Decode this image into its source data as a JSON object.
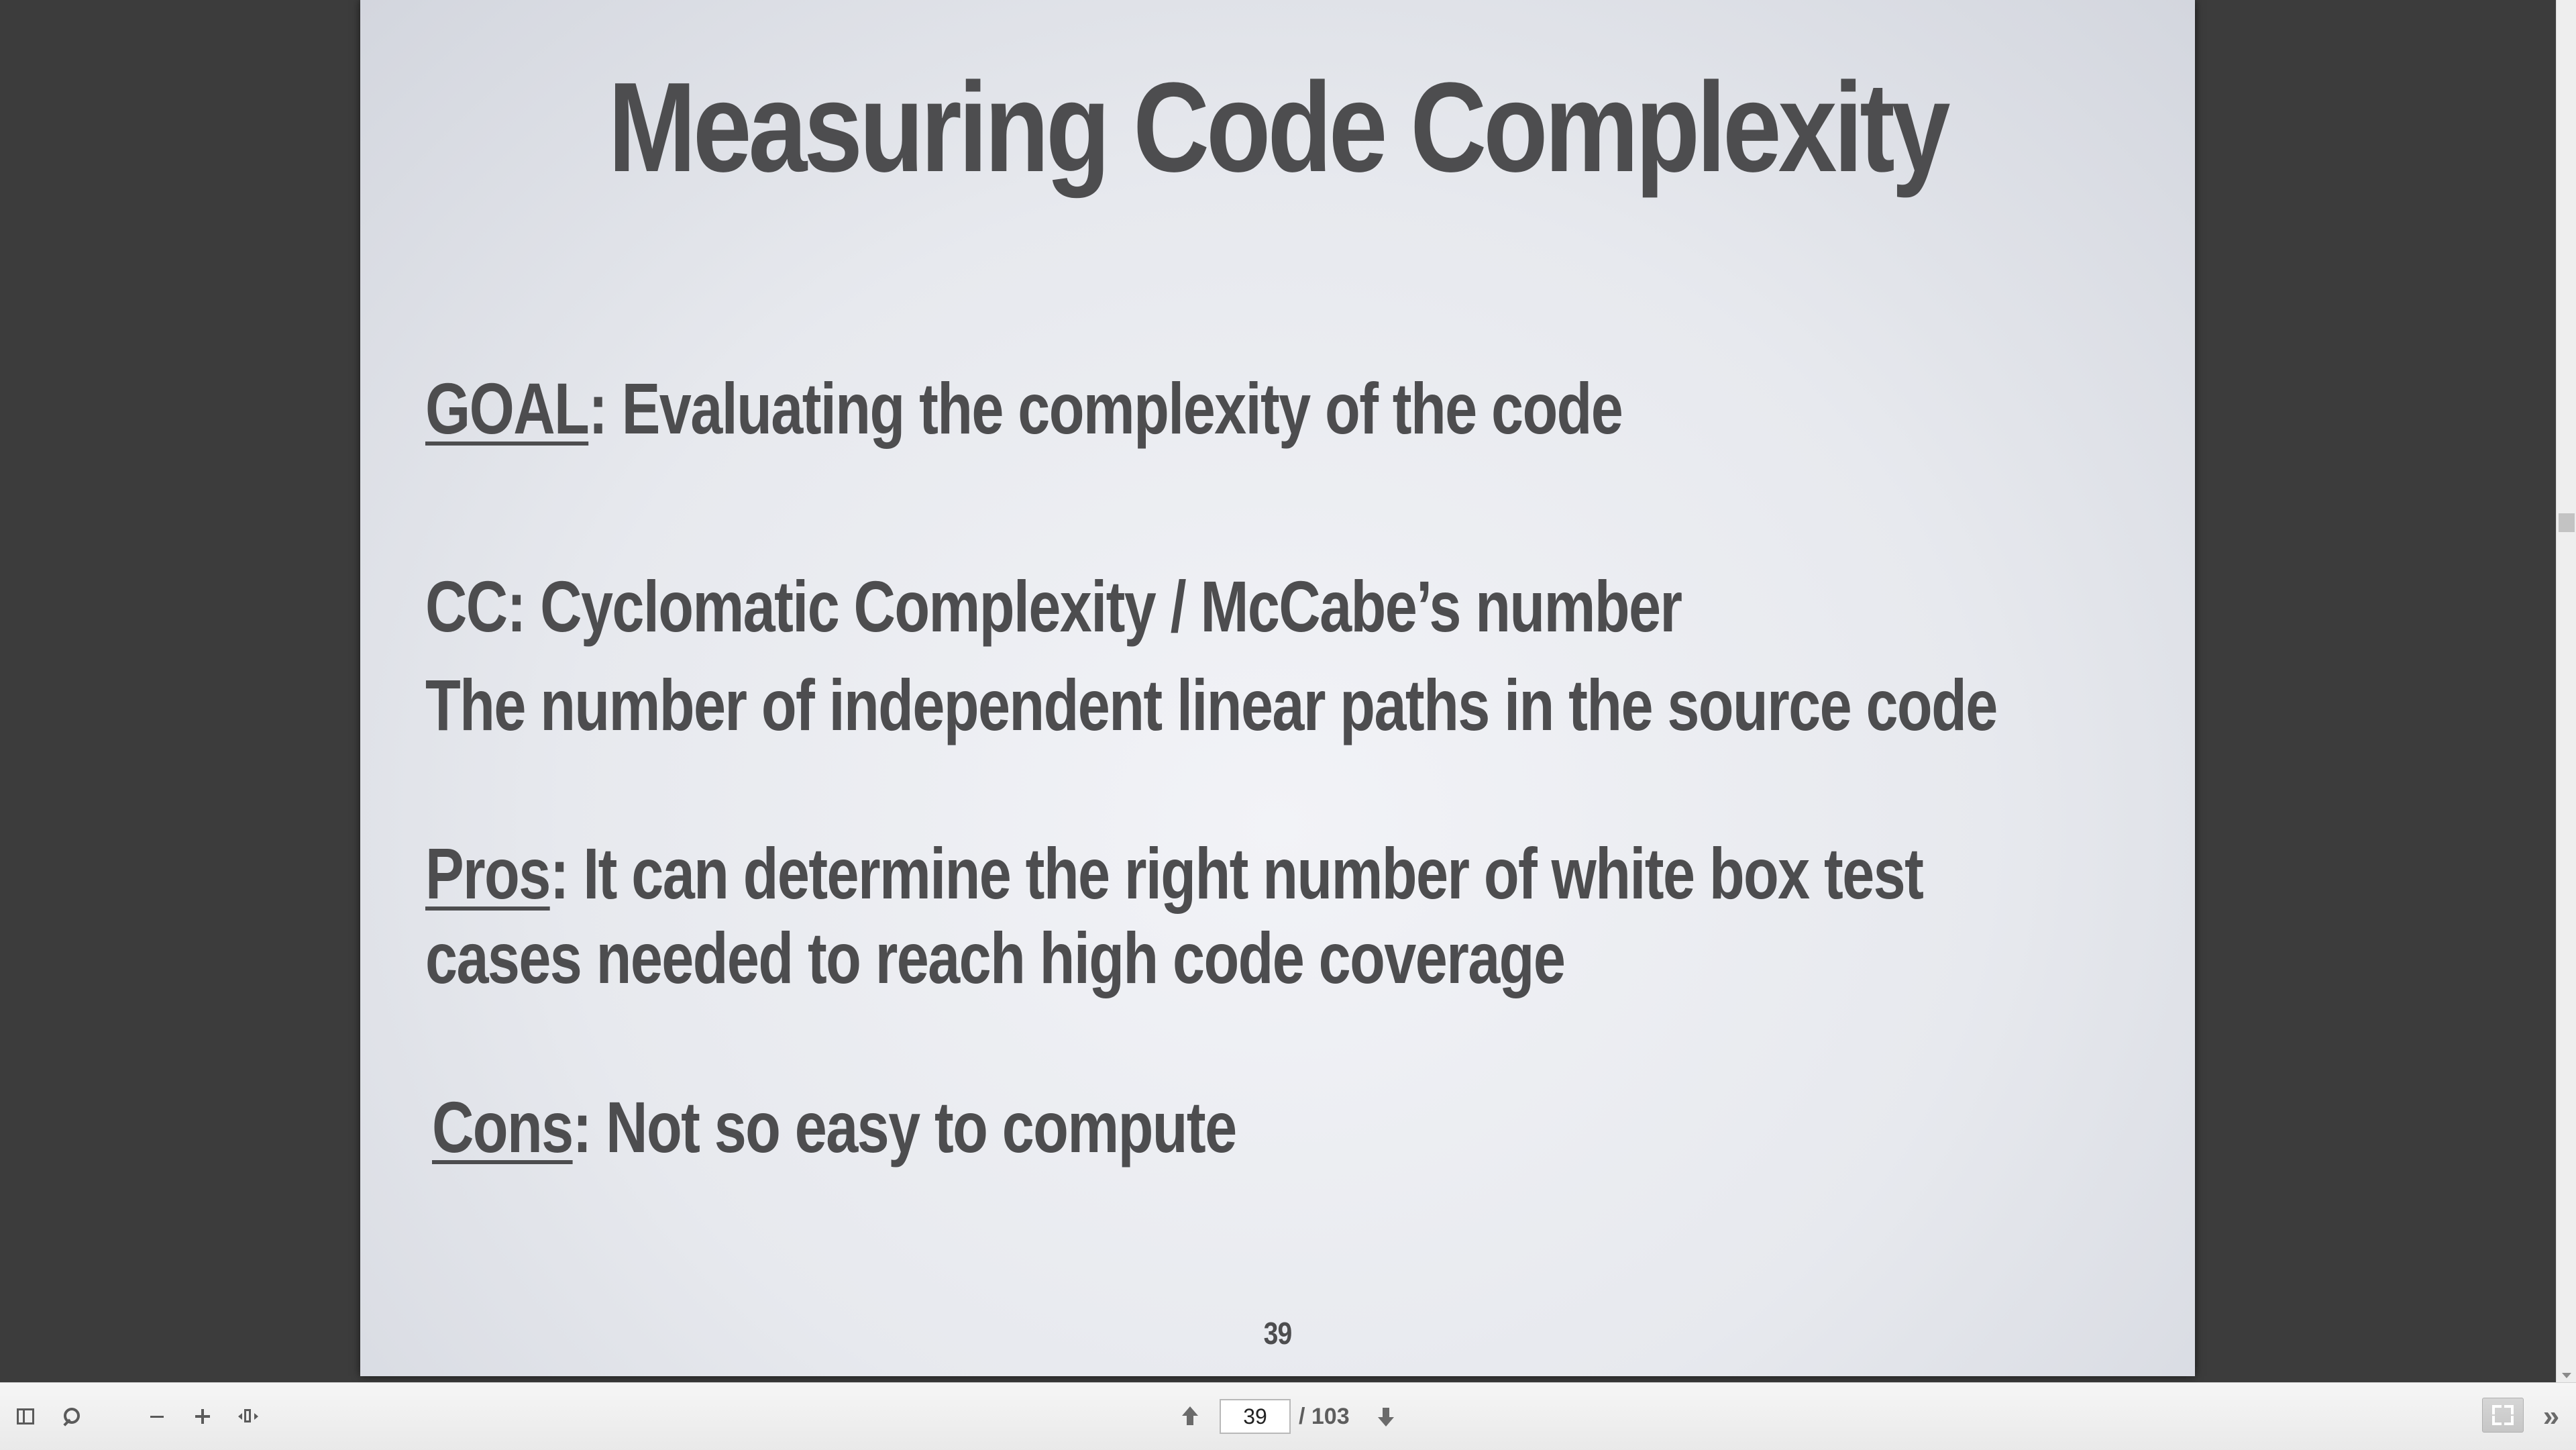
{
  "slide": {
    "title": "Measuring Code Complexity",
    "goal": {
      "label": "GOAL",
      "text": ": Evaluating the complexity of the code"
    },
    "cc_line1": "CC: Cyclomatic Complexity / McCabe’s number",
    "cc_line2": "The number of independent linear paths in the source code",
    "pros": {
      "label": "Pros",
      "text_line1": ": It can determine the right number of white  box test",
      "text_line2": "cases needed to reach high code coverage"
    },
    "cons": {
      "label": "Cons",
      "text": ": Not so easy to compute"
    },
    "page_number": "39"
  },
  "toolbar": {
    "icons": {
      "sidebar": "sidebar-toggle-icon",
      "search": "search-icon",
      "zoom_out": "minus-icon",
      "zoom_in": "plus-icon",
      "fit": "fit-width-icon",
      "prev": "arrow-up-icon",
      "next": "arrow-down-icon",
      "fullscreen": "fullscreen-icon",
      "more": "double-chevron-right-icon"
    },
    "page_input_value": "39",
    "page_total": "/ 103",
    "more_glyph": "»"
  }
}
